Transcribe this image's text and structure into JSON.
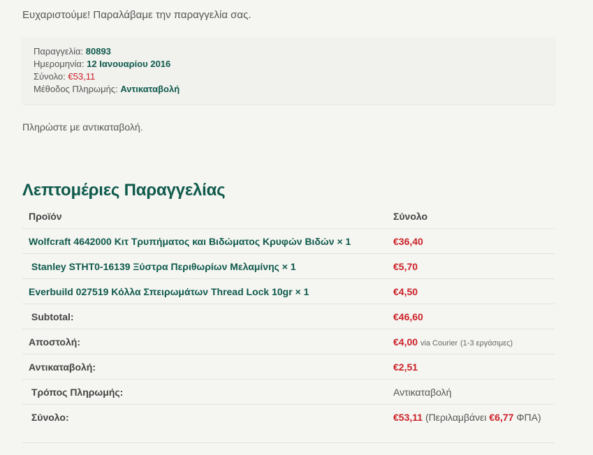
{
  "thanks_text": "Ευχαριστούμε! Παραλάβαμε την παραγγελία σας.",
  "overview": {
    "order_label": "Παραγγελία:",
    "order_value": "80893",
    "date_label": "Ημερομηνία:",
    "date_value": "12 Ιανουαρίου 2016",
    "total_label": "Σύνολο:",
    "total_value": "€53,11",
    "method_label": "Μέθοδος Πληρωμής:",
    "method_value": "Αντικαταβολή"
  },
  "pay_note": "Πληρώστε με αντικαταβολή.",
  "details": {
    "title": "Λεπτομέριες Παραγγελίας",
    "headers": {
      "product": "Προϊόν",
      "total": "Σύνολο"
    },
    "items": [
      {
        "name": "Wolfcraft 4642000 Κιτ Τρυπήματος και Βιδώματος Κρυφών Βιδών",
        "qty": "× 1",
        "total": "€36,40"
      },
      {
        "name": "Stanley STHT0-16139 Ξύστρα Περιθωρίων Μελαμίνης",
        "qty": "× 1",
        "total": "€5,70"
      },
      {
        "name": "Everbuild 027519 Κόλλα Σπειρωμάτων Thread Lock 10gr",
        "qty": "× 1",
        "total": "€4,50"
      }
    ],
    "subtotal": {
      "label": "Subtotal:",
      "value": "€46,60"
    },
    "shipping": {
      "label": "Αποστολή:",
      "value": "€4,00",
      "via": "via Courier",
      "note": "(1-3 εργάσιμες)"
    },
    "cod_fee": {
      "label": "Αντικαταβολή:",
      "value": "€2,51"
    },
    "payment_method": {
      "label": "Τρόπος Πληρωμής:",
      "value": "Αντικαταβολή"
    },
    "total": {
      "label": "Σύνολο:",
      "value": "€53,11",
      "tax_prefix": "(Περιλαμβάνει",
      "tax_value": "€6,77",
      "tax_suffix": "ΦΠΑ)"
    }
  },
  "colors": {
    "accent_green": "#0f5a4b",
    "price_red": "#cc2127",
    "background": "#f5f5f2"
  }
}
